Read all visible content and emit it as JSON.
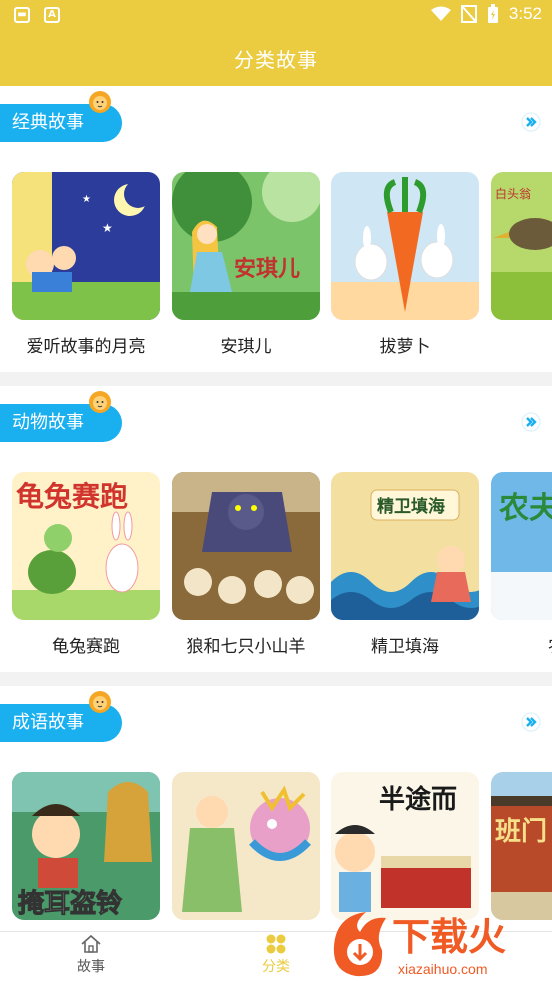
{
  "status_bar": {
    "time": "3:52"
  },
  "header": {
    "title": "分类故事"
  },
  "sections": [
    {
      "title": "经典故事",
      "items": [
        {
          "label": "爱听故事的月亮",
          "overlay": ""
        },
        {
          "label": "安琪儿",
          "overlay": "安琪儿"
        },
        {
          "label": "拔萝卜",
          "overlay": ""
        },
        {
          "label": "白",
          "overlay": "白头翁"
        }
      ]
    },
    {
      "title": "动物故事",
      "items": [
        {
          "label": "龟兔赛跑",
          "overlay": "龟兔赛跑"
        },
        {
          "label": "狼和七只小山羊",
          "overlay": ""
        },
        {
          "label": "精卫填海",
          "overlay": "精卫填海"
        },
        {
          "label": "农夫",
          "overlay": "农夫"
        }
      ]
    },
    {
      "title": "成语故事",
      "items": [
        {
          "label": "",
          "overlay": "掩耳盗铃"
        },
        {
          "label": "",
          "overlay": ""
        },
        {
          "label": "",
          "overlay": "半途而"
        },
        {
          "label": "",
          "overlay": "班门"
        }
      ]
    }
  ],
  "tabbar": {
    "tabs": [
      {
        "label": "故事"
      },
      {
        "label": "分类"
      }
    ],
    "active_color": "#ebcb3f",
    "inactive_color": "#555555"
  },
  "watermark": {
    "brand": "下载火",
    "url": "xiazaihuo.com"
  },
  "colors": {
    "header": "#ebcb3f",
    "section_pill": "#1ab0f0",
    "watermark": "#f05a24"
  }
}
